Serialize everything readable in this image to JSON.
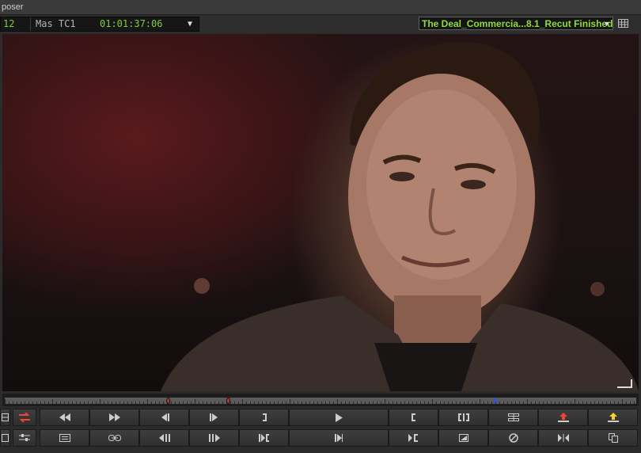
{
  "window": {
    "title": "poser"
  },
  "timecode_bar": {
    "track_number": "12",
    "tc_label": "Mas TC1",
    "tc_value": "01:01:37:06",
    "sequence_name": "The Deal_Commercia...8.1_Recut Finished"
  },
  "icons": {
    "dropdown": "chevron-down-icon",
    "grid": "grid-icon",
    "corner": "resize-corner-icon"
  },
  "colors": {
    "timecode_green": "#7fcf3a",
    "sequence_green": "#8fdc3a",
    "mark_in_marker": "#c0392b",
    "position_indicator": "#2f4cff"
  },
  "scrubber": {
    "position": 0.776,
    "markers": [
      0.259,
      0.354
    ]
  },
  "toolbar_row1": [
    "rewind-icon",
    "fast-forward-icon",
    "step-back-frame-icon",
    "step-forward-frame-icon",
    "mark-out-icon",
    "play-icon",
    "mark-in-icon",
    "mark-clip-icon",
    "add-edit-icon",
    "lift-icon",
    "extract-icon"
  ],
  "toolbar_row2": [
    "list-icon",
    "link-icon",
    "step-back-icon",
    "step-forward-icon",
    "go-to-out-icon",
    "go-to-next-icon",
    "go-to-in-icon",
    "match-frame-icon",
    "clear-icon",
    "trim-icon",
    "copy-icon"
  ]
}
